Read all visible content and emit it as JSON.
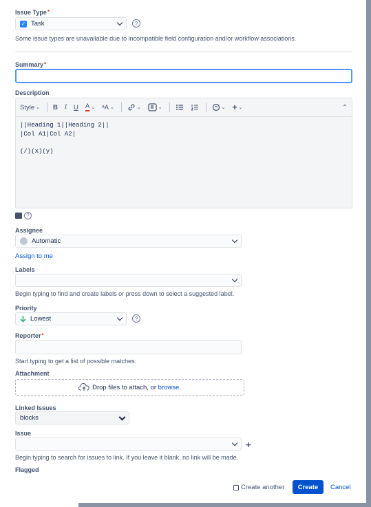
{
  "issue_type": {
    "label": "Issue Type",
    "required_mark": "*",
    "value": "Task",
    "help": "Some issue types are unavailable due to incompatible field configuration and/or workflow associations."
  },
  "summary": {
    "label": "Summary",
    "required_mark": "*",
    "value": ""
  },
  "description": {
    "label": "Description",
    "toolbar": {
      "style": "Style",
      "bold": "B",
      "italic": "I",
      "underline": "U",
      "text_color": "A",
      "more_format": "ᵃA",
      "collapse": "⌃"
    },
    "content": "||Heading 1||Heading 2||\n|Col A1|Col A2|\n\n(/)(x)(y)"
  },
  "assignee": {
    "label": "Assignee",
    "value": "Automatic",
    "assign_to_me": "Assign to me"
  },
  "labels": {
    "label": "Labels",
    "value": "",
    "help": "Begin typing to find and create labels or press down to select a suggested label."
  },
  "priority": {
    "label": "Priority",
    "value": "Lowest",
    "color": "#36b37e"
  },
  "reporter": {
    "label": "Reporter",
    "required_mark": "*",
    "value": "",
    "help": "Start typing to get a list of possible matches."
  },
  "attachment": {
    "label": "Attachment",
    "drop_text": "Drop files to attach, or ",
    "browse": "browse."
  },
  "linked_issues": {
    "label": "Linked Issues",
    "value": "blocks"
  },
  "issue": {
    "label": "Issue",
    "value": "",
    "help": "Begin typing to search for issues to link. If you leave it blank, no link will be made."
  },
  "flagged": {
    "label": "Flagged"
  },
  "footer": {
    "create_another": "Create another",
    "create": "Create",
    "cancel": "Cancel"
  },
  "colors": {
    "primary": "#0052cc",
    "focus": "#4c9aff",
    "required": "#de350b"
  }
}
